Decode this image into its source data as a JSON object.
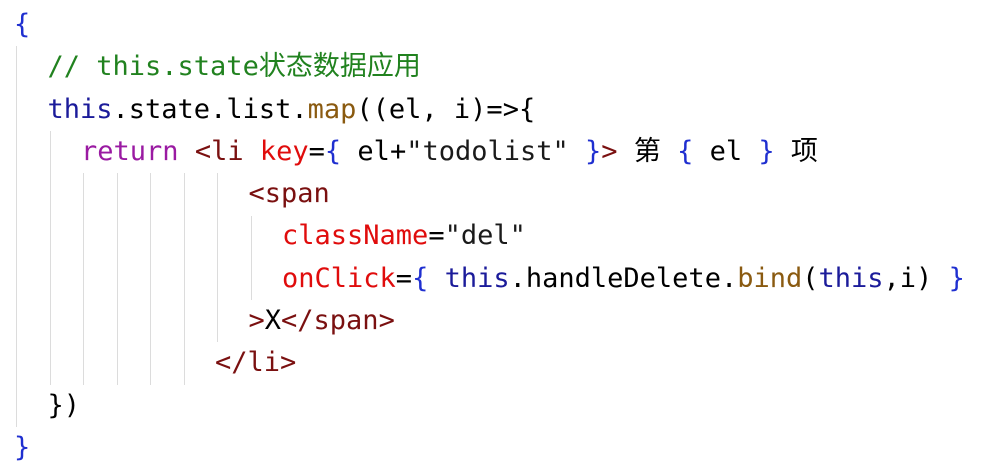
{
  "colors": {
    "brace": "#1f2fd0",
    "comment": "#21821f",
    "keyword_this": "#1b1b9a",
    "plain": "#000000",
    "method": "#8a5a10",
    "purple": "#9a1aa2",
    "tag": "#7a1010",
    "attr": "#e00c0c",
    "string": "#1a1a1a",
    "guide": "#dcdcdc"
  },
  "code": {
    "lines": [
      {
        "indent": 0,
        "tokens": [
          {
            "t": "{",
            "c": "brace"
          }
        ]
      },
      {
        "indent": 1,
        "tokens": [
          {
            "t": "// this.state状态数据应用",
            "c": "comment"
          }
        ]
      },
      {
        "indent": 1,
        "tokens": [
          {
            "t": "this",
            "c": "keyword_this"
          },
          {
            "t": ".state.list.",
            "c": "plain"
          },
          {
            "t": "map",
            "c": "method"
          },
          {
            "t": "((el, i)=>{",
            "c": "plain"
          }
        ]
      },
      {
        "indent": 2,
        "tokens": [
          {
            "t": "return",
            "c": "purple"
          },
          {
            "t": " ",
            "c": "plain"
          },
          {
            "t": "<li",
            "c": "tag"
          },
          {
            "t": " ",
            "c": "plain"
          },
          {
            "t": "key",
            "c": "attr"
          },
          {
            "t": "=",
            "c": "plain"
          },
          {
            "t": "{",
            "c": "brace"
          },
          {
            "t": " el+",
            "c": "plain"
          },
          {
            "t": "\"todolist\"",
            "c": "string"
          },
          {
            "t": " ",
            "c": "plain"
          },
          {
            "t": "}",
            "c": "brace"
          },
          {
            "t": ">",
            "c": "tag"
          },
          {
            "t": " 第 ",
            "c": "plain"
          },
          {
            "t": "{",
            "c": "brace"
          },
          {
            "t": " el ",
            "c": "plain"
          },
          {
            "t": "}",
            "c": "brace"
          },
          {
            "t": " 项",
            "c": "plain"
          }
        ]
      },
      {
        "indent": 7,
        "tokens": [
          {
            "t": "<span",
            "c": "tag"
          }
        ]
      },
      {
        "indent": 8,
        "tokens": [
          {
            "t": "className",
            "c": "attr"
          },
          {
            "t": "=",
            "c": "plain"
          },
          {
            "t": "\"del\"",
            "c": "string"
          }
        ]
      },
      {
        "indent": 8,
        "tokens": [
          {
            "t": "onClick",
            "c": "attr"
          },
          {
            "t": "=",
            "c": "plain"
          },
          {
            "t": "{",
            "c": "brace"
          },
          {
            "t": " ",
            "c": "plain"
          },
          {
            "t": "this",
            "c": "keyword_this"
          },
          {
            "t": ".handleDelete.",
            "c": "plain"
          },
          {
            "t": "bind",
            "c": "method"
          },
          {
            "t": "(",
            "c": "plain"
          },
          {
            "t": "this",
            "c": "keyword_this"
          },
          {
            "t": ",i) ",
            "c": "plain"
          },
          {
            "t": "}",
            "c": "brace"
          }
        ]
      },
      {
        "indent": 7,
        "tokens": [
          {
            "t": ">",
            "c": "tag"
          },
          {
            "t": "X",
            "c": "plain"
          },
          {
            "t": "</span>",
            "c": "tag"
          }
        ]
      },
      {
        "indent": 6,
        "tokens": [
          {
            "t": "</li>",
            "c": "tag"
          }
        ]
      },
      {
        "indent": 1,
        "tokens": [
          {
            "t": "})",
            "c": "plain"
          }
        ]
      },
      {
        "indent": 0,
        "tokens": [
          {
            "t": "}",
            "c": "brace"
          }
        ]
      }
    ]
  }
}
